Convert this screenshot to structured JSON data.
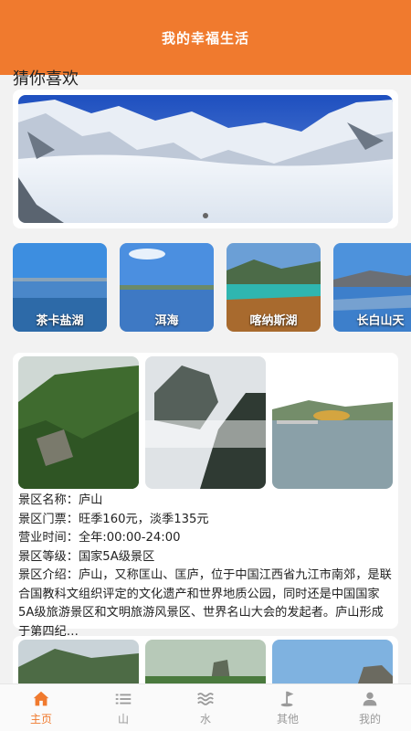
{
  "header": {
    "title": "我的幸福生活"
  },
  "section_title": "猜你喜欢",
  "banner": {
    "image": "snow-mountain-banner"
  },
  "lakes": [
    {
      "label": "茶卡盐湖"
    },
    {
      "label": "洱海"
    },
    {
      "label": "喀纳斯湖"
    },
    {
      "label": "长白山天"
    }
  ],
  "scenic": {
    "name_label": "景区名称：",
    "name": "庐山",
    "ticket_label": "景区门票：",
    "ticket": "旺季160元，淡季135元",
    "hours_label": "营业时间：",
    "hours": "全年:00:00-24:00",
    "level_label": "景区等级：",
    "level": "国家5A级景区",
    "intro_label": "景区介绍：",
    "intro": "庐山，又称匡山、匡庐，位于中国江西省九江市南郊，是联合国教科文组织评定的文化遗产和世界地质公园，同时还是中国国家5A级旅游景区和文明旅游风景区、世界名山大会的发起者。庐山形成于第四纪…"
  },
  "tabs": [
    {
      "label": "主页",
      "icon": "home-icon",
      "active": true
    },
    {
      "label": "山",
      "icon": "list-icon",
      "active": false
    },
    {
      "label": "水",
      "icon": "water-icon",
      "active": false
    },
    {
      "label": "其他",
      "icon": "golf-flag-icon",
      "active": false
    },
    {
      "label": "我的",
      "icon": "user-icon",
      "active": false
    }
  ],
  "colors": {
    "accent": "#f07a2e",
    "tab_inactive": "#9a9a9a"
  }
}
